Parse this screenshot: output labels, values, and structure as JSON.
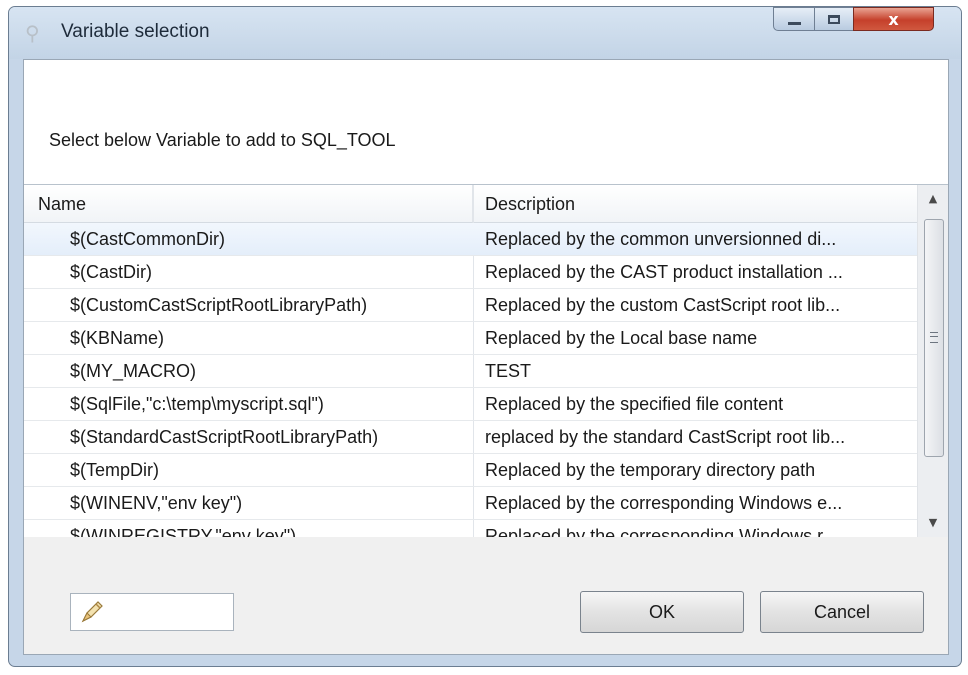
{
  "window": {
    "title": "Variable selection",
    "app_icon": "tool-icon",
    "controls": {
      "minimize_icon": "minimize-icon",
      "maximize_icon": "maximize-icon",
      "close_icon": "close-icon",
      "close_glyph": "x"
    }
  },
  "instruction": "Select below Variable to add to SQL_TOOL",
  "table": {
    "columns": {
      "name": "Name",
      "description": "Description"
    },
    "rows": [
      {
        "name": "$(CastCommonDir)",
        "description": "Replaced by the common unversionned di...",
        "selected": true
      },
      {
        "name": "$(CastDir)",
        "description": "Replaced by the CAST product installation ..."
      },
      {
        "name": "$(CustomCastScriptRootLibraryPath)",
        "description": "Replaced by the custom CastScript root lib..."
      },
      {
        "name": "$(KBName)",
        "description": "Replaced by the Local base name"
      },
      {
        "name": "$(MY_MACRO)",
        "description": "TEST"
      },
      {
        "name": "$(SqlFile,\"c:\\temp\\myscript.sql\")",
        "description": "Replaced by the specified file content"
      },
      {
        "name": "$(StandardCastScriptRootLibraryPath)",
        "description": "replaced by the standard CastScript root lib..."
      },
      {
        "name": "$(TempDir)",
        "description": "Replaced by the temporary directory path"
      },
      {
        "name": "$(WINENV,\"env key\")",
        "description": "Replaced by the corresponding Windows e..."
      },
      {
        "name": "$(WINREGISTRY,\"env key\")",
        "description": "Replaced by the corresponding Windows r..."
      }
    ],
    "scrollbar": {
      "up_icon": "scroll-up-icon",
      "down_icon": "scroll-down-icon",
      "position": 0.0
    }
  },
  "footer": {
    "filter_icon": "pen-icon",
    "ok_label": "OK",
    "cancel_label": "Cancel"
  }
}
